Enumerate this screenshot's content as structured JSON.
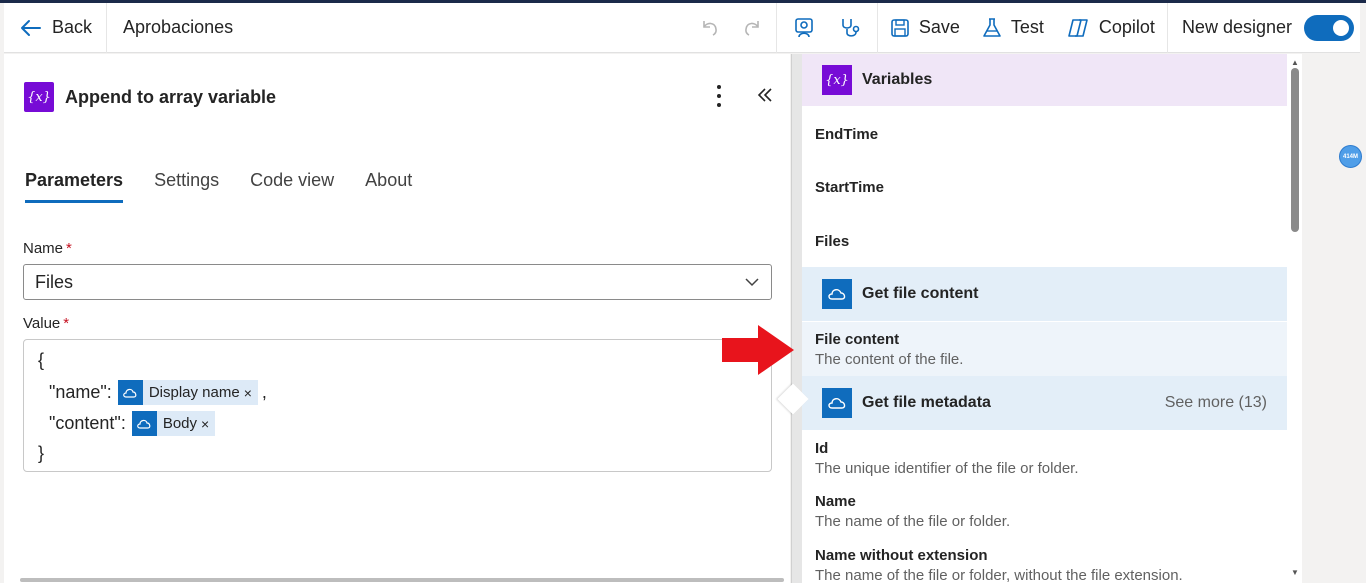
{
  "toolbar": {
    "back_label": "Back",
    "flow_name": "Aprobaciones",
    "save_label": "Save",
    "test_label": "Test",
    "copilot_label": "Copilot",
    "new_designer_label": "New designer",
    "new_designer_on": true
  },
  "action": {
    "icon_text": "{x}",
    "title": "Append to array variable"
  },
  "tabs": [
    {
      "label": "Parameters",
      "active": true
    },
    {
      "label": "Settings",
      "active": false
    },
    {
      "label": "Code view",
      "active": false
    },
    {
      "label": "About",
      "active": false
    }
  ],
  "form": {
    "name_label": "Name",
    "required_mark": "*",
    "name_value": "Files",
    "value_label": "Value",
    "json": {
      "open": "{",
      "close": "}",
      "lines": [
        {
          "key": "\"name\":",
          "token": "Display name",
          "suffix": ","
        },
        {
          "key": "\"content\":",
          "token": "Body",
          "suffix": ""
        }
      ],
      "remove_glyph": "×"
    }
  },
  "picker": {
    "variables_title": "Variables",
    "variables_icon_text": "{x}",
    "variables": [
      "EndTime",
      "StartTime",
      "Files"
    ],
    "groups": [
      {
        "title": "Get file content",
        "items": [
          {
            "name": "File content",
            "desc": "The content of the file."
          }
        ]
      },
      {
        "title": "Get file metadata",
        "see_more": "See more (13)",
        "items": [
          {
            "name": "Id",
            "desc": "The unique identifier of the file or folder."
          },
          {
            "name": "Name",
            "desc": "The name of the file or folder."
          },
          {
            "name": "Name without extension",
            "desc": "The name of the file or folder, without the file extension."
          }
        ]
      }
    ]
  },
  "canvas": {
    "minimap_badge": "414M"
  },
  "colors": {
    "accent": "#0f6cbd",
    "variable_purple": "#770bd6",
    "arrow_red": "#e8141c"
  }
}
